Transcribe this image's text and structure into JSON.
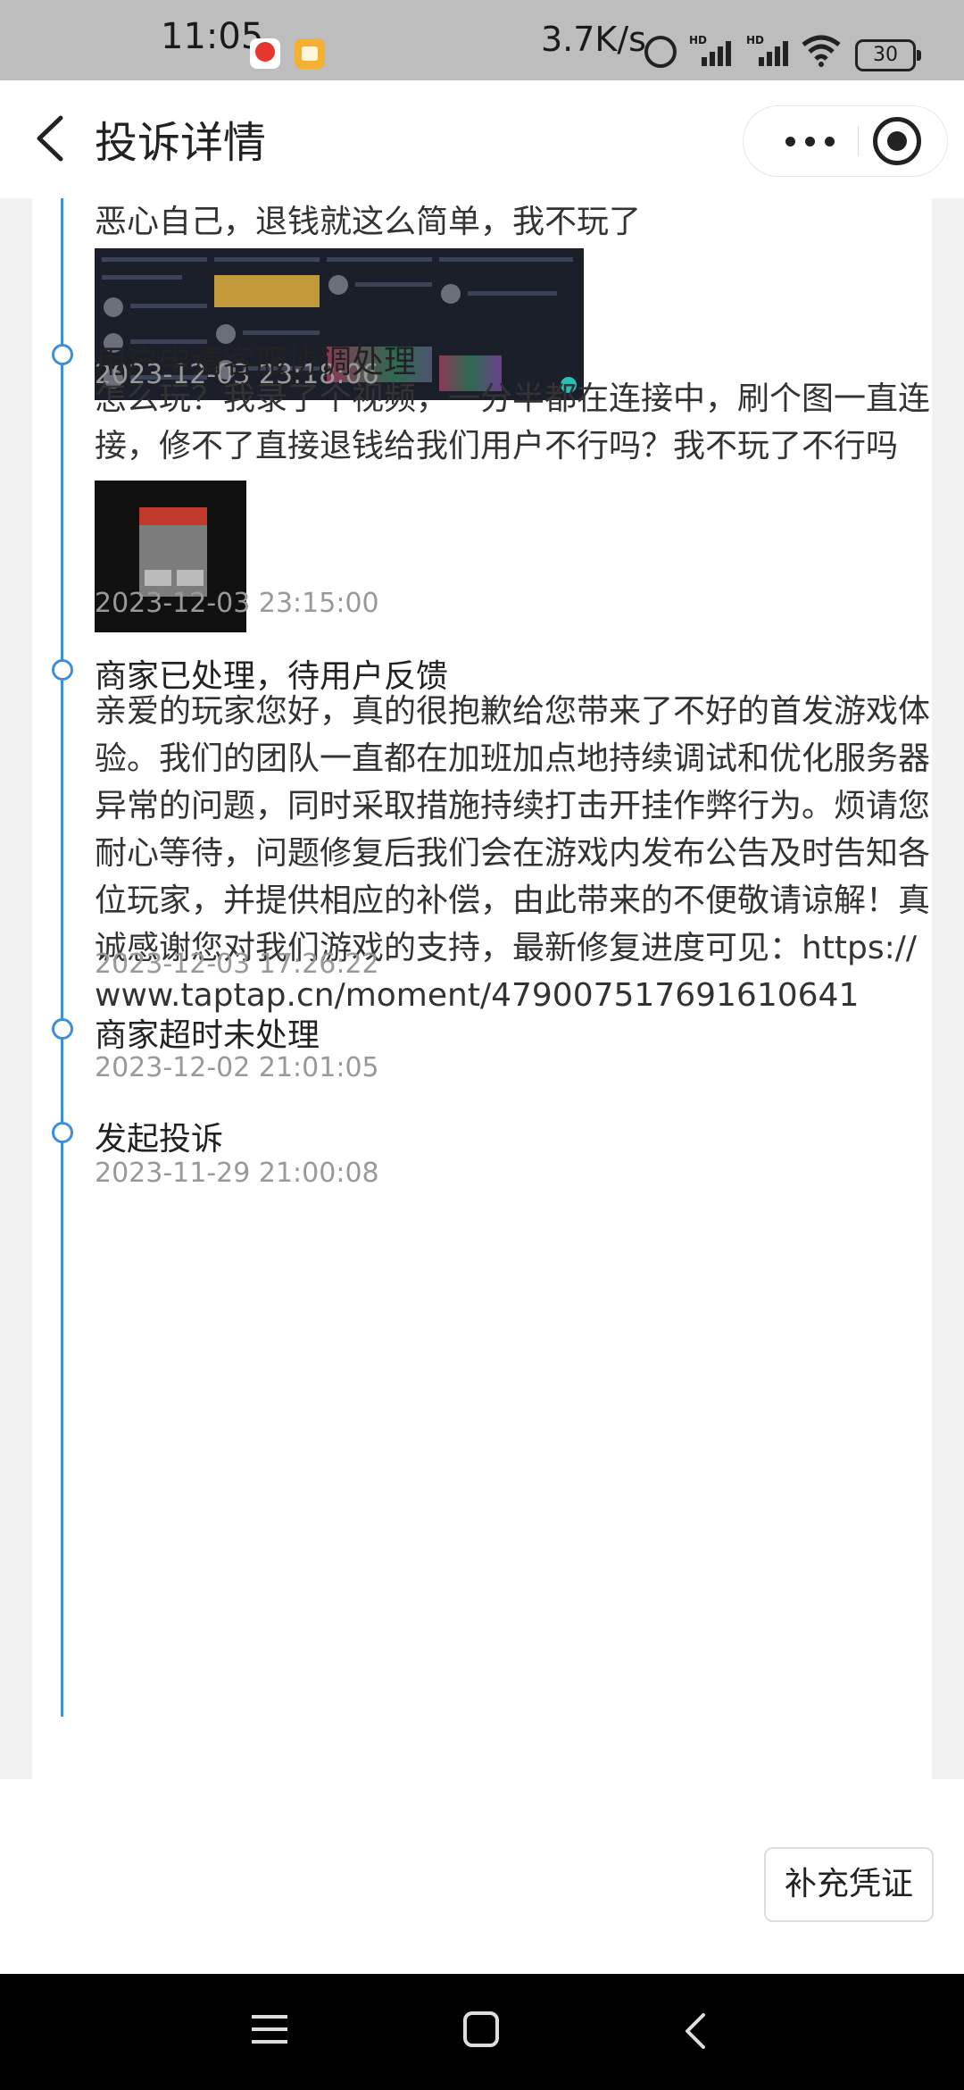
{
  "status_bar": {
    "time": "11:05",
    "speed": "3.7K/s",
    "battery": "30",
    "hd_label": "HD"
  },
  "header": {
    "title": "投诉详情"
  },
  "events": [
    {
      "text": "恶心自己，退钱就这么简单，我不玩了",
      "time": "2023-12-03 23:18:06"
    },
    {
      "title": "用户申请客服协调处理",
      "text": "怎么玩？我录了个视频，一分半都在连接中，刷个图一直连接，修不了直接退钱给我们用户不行吗？我不玩了不行吗",
      "time": "2023-12-03 23:15:00"
    },
    {
      "title": "商家已处理，待用户反馈",
      "text": "亲爱的玩家您好，真的很抱歉给您带来了不好的首发游戏体验。我们的团队一直都在加班加点地持续调试和优化服务器异常的问题，同时采取措施持续打击开挂作弊行为。烦请您耐心等待，问题修复后我们会在游戏内发布公告及时告知各位玩家，并提供相应的补偿，由此带来的不便敬请谅解！真诚感谢您对我们游戏的支持，最新修复进度可见：https://www.taptap.cn/moment/479007517691610641",
      "time": "2023-12-03 17:26:22"
    },
    {
      "title": "商家超时未处理",
      "time": "2023-12-02 21:01:05"
    },
    {
      "title": "发起投诉",
      "time": "2023-11-29 21:00:08"
    }
  ],
  "actions": {
    "supplement": "补充凭证"
  },
  "colors": {
    "accent": "#3f8fd8"
  }
}
